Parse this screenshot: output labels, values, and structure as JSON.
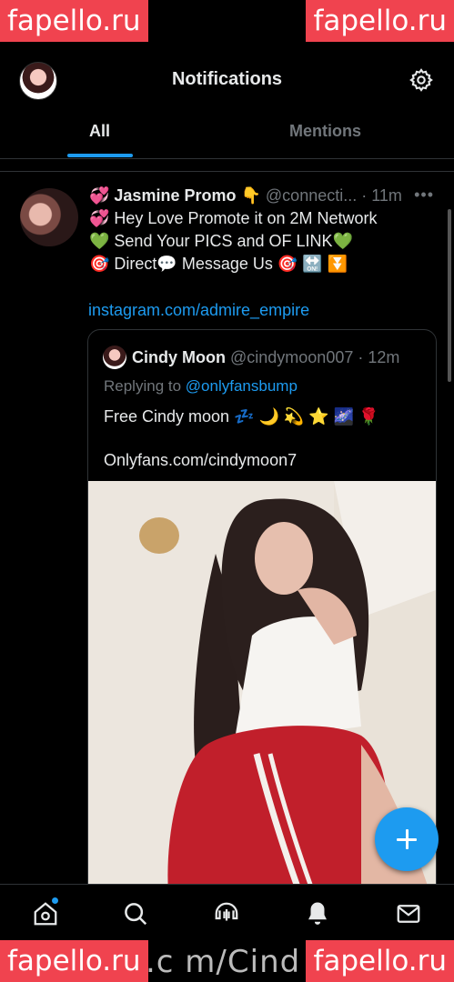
{
  "watermarks": {
    "top_left": "fapello.ru",
    "top_right": "fapello.ru",
    "bottom_left": "fapello.ru",
    "bottom_right": "fapello.ru",
    "footer_text": ".c m/Cind"
  },
  "header": {
    "title": "Notifications",
    "avatar_icon": "profile-avatar",
    "settings_icon": "gear-icon"
  },
  "tabs": [
    {
      "label": "All",
      "active": true
    },
    {
      "label": "Mentions",
      "active": false
    }
  ],
  "tweet": {
    "author_name": "💞 Jasmine Promo 👇",
    "handle": "@connecti...",
    "time": "· 11m",
    "more_icon": "more-dots-icon",
    "lines": [
      "💞 Hey Love Promote it on 2M Network",
      "💚 Send Your PICS and OF LINK💚",
      "🎯 Direct💬 Message Us 🎯 🔛 ⏬"
    ],
    "link": "instagram.com/admire_empire",
    "quote": {
      "author_name": "Cindy Moon",
      "handle": "@cindymoon007",
      "time": "· 12m",
      "reply_prefix": "Replying to",
      "reply_mention": "@onlyfansbump",
      "text": "Free Cindy moon 💤 🌙 💫 ⭐ 🌌 🌹",
      "url_text": "Onlyfans.com/cindymoon7"
    }
  },
  "fab": {
    "icon": "compose-plus-icon"
  },
  "bottom_nav": [
    {
      "icon": "home-icon"
    },
    {
      "icon": "search-icon"
    },
    {
      "icon": "spaces-icon"
    },
    {
      "icon": "bell-icon"
    },
    {
      "icon": "mail-icon"
    }
  ],
  "colors": {
    "accent": "#1d9bf0",
    "background": "#000000",
    "text": "#e7e9ea",
    "muted": "#71767b",
    "watermark": "#f0434f"
  }
}
